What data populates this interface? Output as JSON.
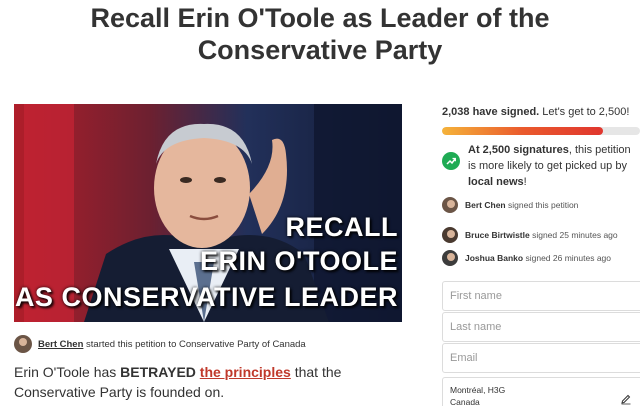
{
  "page": {
    "title": "Recall Erin O'Toole as Leader of the Conservative Party"
  },
  "hero": {
    "line1": "RECALL",
    "line2": "ERIN O'TOOLE",
    "line3": "AS CONSERVATIVE LEADER"
  },
  "starter": {
    "name": "Bert Chen",
    "text": "started this petition to Conservative Party of Canada"
  },
  "description": {
    "part1": "Erin O'Toole has ",
    "strong": "BETRAYED",
    "space": " ",
    "link": "the principles",
    "part2": " that the Conservative Party is founded on."
  },
  "signatures": {
    "count_text": "2,038 have signed.",
    "goal_text": "Let's get to 2,500!",
    "progress": 0.8152
  },
  "goal": {
    "strong1": "At 2,500 signatures",
    "text1": ", this petition is more likely to get picked up by ",
    "strong2": "local news",
    "text2": "!"
  },
  "recent_signers": [
    {
      "name": "Bert Chen",
      "action": "signed this petition"
    },
    {
      "name": "Bruce Birtwistle",
      "action": "signed 25 minutes ago"
    },
    {
      "name": "Joshua Banko",
      "action": "signed 26 minutes ago"
    }
  ],
  "form": {
    "first_name_placeholder": "First name",
    "last_name_placeholder": "Last name",
    "email_placeholder": "Email",
    "location_line1": "Montréal, H3G",
    "location_line2": "Canada"
  },
  "colors": {
    "accent_red": "#e0362e",
    "progress_orange": "#f5b33a",
    "success_green": "#1fab54"
  },
  "icons": [
    "trend-up-icon",
    "edit-icon"
  ]
}
